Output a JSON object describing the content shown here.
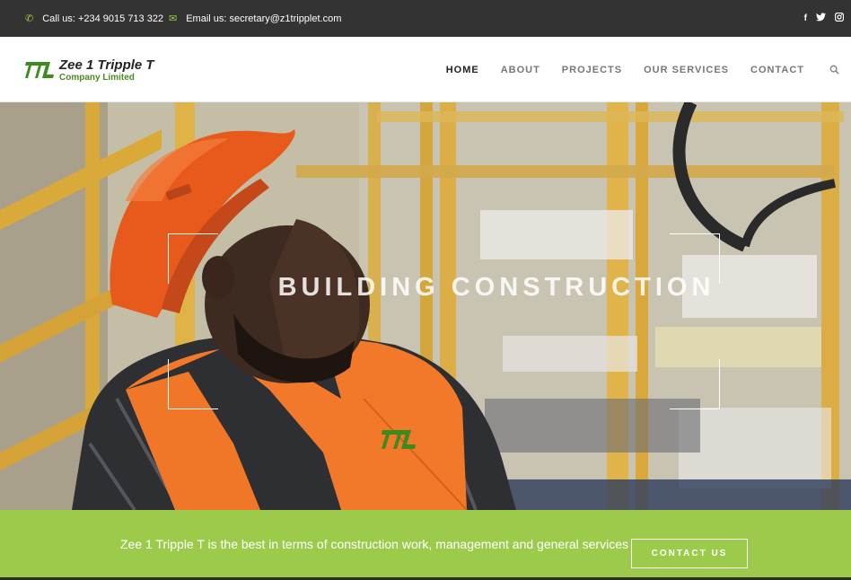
{
  "topbar": {
    "phone_icon": "phone-icon",
    "phone": "Call us: +234 9015 713 322",
    "email_icon": "envelope-icon",
    "email": "Email us: secretary@z1tripplet.com",
    "social": {
      "facebook": "f",
      "twitter": "twitter-icon",
      "instagram": "instagram-icon"
    }
  },
  "header": {
    "logo_name": "Zee 1 Tripple T",
    "logo_sub": "Company Limited",
    "nav": [
      "HOME",
      "ABOUT",
      "PROJECTS",
      "OUR SERVICES",
      "CONTACT"
    ],
    "active": "HOME",
    "search_icon": "search-icon"
  },
  "hero": {
    "title": "BUILDING CONSTRUCTION"
  },
  "cta": {
    "text": "Zee 1 Tripple T is the best in terms of construction work, management and general services",
    "button": "CONTACT US"
  },
  "colors": {
    "accent": "#9ccb4b",
    "topbar": "#333333",
    "hard_hat": "#e8571a",
    "vest": "#f47a2a"
  }
}
